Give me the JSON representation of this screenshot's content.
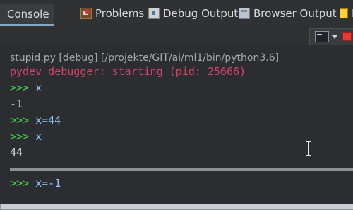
{
  "tabs": [
    {
      "label": "Console",
      "icon": "console-icon",
      "active": true
    },
    {
      "label": "Problems",
      "icon": "problems-icon",
      "active": false
    },
    {
      "label": "Debug Output",
      "icon": "debug-output-icon",
      "active": false
    },
    {
      "label": "Browser Output",
      "icon": "browser-output-icon",
      "active": false
    },
    {
      "label": "P",
      "icon": "extra-view-icon",
      "active": false
    }
  ],
  "toolbar": {
    "icons": [
      "open-console-icon",
      "view-menu-icon",
      "terminate-icon"
    ]
  },
  "console": {
    "header": "stupid.py [debug] [/projekte/GIT/ai/ml1/bin/python3.6]",
    "start_line": "pydev debugger: starting (pid: 25666)",
    "prompt": ">>>",
    "lines": [
      {
        "kind": "input",
        "prompt": ">>>",
        "text": "x"
      },
      {
        "kind": "output",
        "text": "-1"
      },
      {
        "kind": "input",
        "prompt": ">>>",
        "text": "x=44"
      },
      {
        "kind": "input",
        "prompt": ">>>",
        "text": "x"
      },
      {
        "kind": "output",
        "text": "44"
      }
    ],
    "current_input": {
      "prompt": ">>>",
      "text": "x=-1"
    }
  },
  "colors": {
    "background": "#2b2d30",
    "prompt": "#46d34b",
    "command": "#8ec8ff",
    "start_line": "#d8436a",
    "output": "#d4d4d4"
  }
}
